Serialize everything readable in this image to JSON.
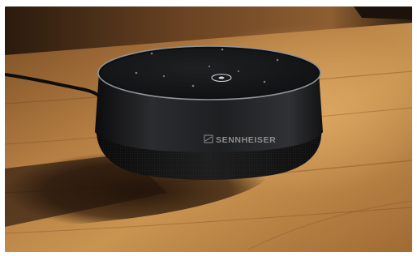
{
  "image": {
    "subject": "conference-speaker",
    "brand": "SENNHEISER",
    "colors": {
      "table_light": "#c8904a",
      "table_mid": "#9a6530",
      "table_dark": "#3e2512",
      "device_body": "#1b1c1e",
      "device_top": "#151618",
      "ring_highlight": "#9a9ea3",
      "indicator": "#c9ccd0"
    }
  }
}
